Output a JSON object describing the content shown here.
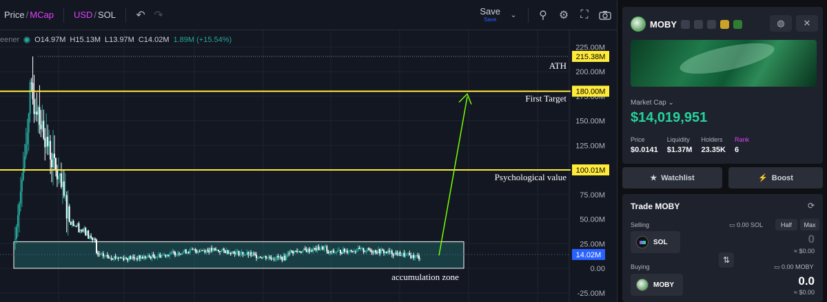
{
  "toolbar": {
    "price_label": "Price",
    "sep": "/",
    "mcap_label": "MCap",
    "usd_label": "USD",
    "sol_label": "SOL",
    "save_label": "Save",
    "save_sub": "Save"
  },
  "legend": {
    "source": "eener",
    "open": "O14.97M",
    "high": "H15.13M",
    "low": "L13.97M",
    "close": "C14.02M",
    "change": "1.89M (+15.54%)"
  },
  "chart_data": {
    "type": "candlestick",
    "y_unit": "M",
    "ylim": [
      -25,
      225
    ],
    "y_ticks": [
      "225.00M",
      "200.00M",
      "175.00M",
      "150.00M",
      "125.00M",
      "100.00M",
      "75.00M",
      "50.00M",
      "25.00M",
      "0.00",
      "-25.00M"
    ],
    "ath_value": 215.38,
    "ath_label": "215.38M",
    "current_value": 14.02,
    "current_label": "14.02M",
    "levels": [
      {
        "value": 180.0,
        "label": "180.00M",
        "text": "First Target"
      },
      {
        "value": 100.01,
        "label": "100.01M",
        "text": "Psychological value"
      }
    ],
    "annotations": {
      "ath": "ATH",
      "zone": "accumulation zone"
    },
    "zone_range": [
      0,
      27
    ],
    "colors": {
      "up": "#26a69a",
      "down": "#ffffff",
      "level": "#ffeb3b",
      "arrow": "#76ff03",
      "zone": "#26a69a",
      "price": "#2962ff"
    }
  },
  "panel": {
    "token_name": "MOBY",
    "market_cap_label": "Market Cap",
    "market_cap_value": "$14,019,951",
    "stats": [
      {
        "k": "Price",
        "v": "$0.0141"
      },
      {
        "k": "Liquidity",
        "v": "$1.37M"
      },
      {
        "k": "Holders",
        "v": "23.35K"
      },
      {
        "k": "Rank",
        "v": "6"
      }
    ],
    "watchlist_label": "Watchlist",
    "boost_label": "Boost",
    "trade_title": "Trade MOBY",
    "selling_label": "Selling",
    "selling_balance": "0.00 SOL",
    "half_label": "Half",
    "max_label": "Max",
    "sell_coin": "SOL",
    "sell_amount": "0",
    "sell_usd": "≈ $0.00",
    "buying_label": "Buying",
    "buying_balance": "0.00 MOBY",
    "buy_coin": "MOBY",
    "buy_amount": "0.0",
    "buy_usd": "≈ $0.00"
  }
}
